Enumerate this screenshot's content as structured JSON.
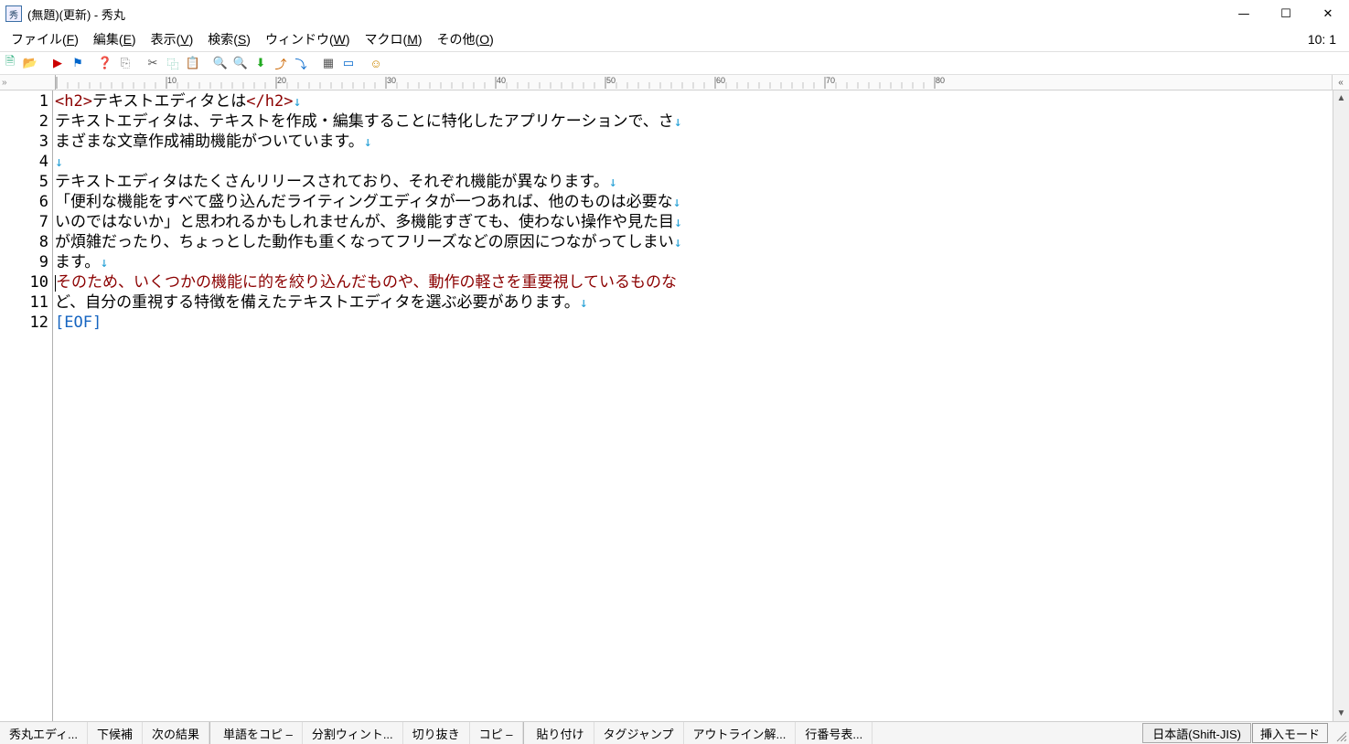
{
  "titlebar": {
    "text": "(無題)(更新) - 秀丸"
  },
  "window_controls": {
    "minimize": "—",
    "maximize": "☐",
    "close": "✕"
  },
  "menubar": {
    "items": [
      {
        "label": "ファイル",
        "accel": "F"
      },
      {
        "label": "編集",
        "accel": "E"
      },
      {
        "label": "表示",
        "accel": "V"
      },
      {
        "label": "検索",
        "accel": "S"
      },
      {
        "label": "ウィンドウ",
        "accel": "W"
      },
      {
        "label": "マクロ",
        "accel": "M"
      },
      {
        "label": "その他",
        "accel": "O"
      }
    ],
    "position": "10: 1"
  },
  "toolbar": {
    "icons": [
      "new-file",
      "open-file",
      "record",
      "bookmark",
      "",
      "toggle-mark",
      "clip",
      "cut",
      "copy",
      "paste",
      "search",
      "find-prev",
      "find-next",
      "jump",
      "",
      "view1",
      "split",
      "help"
    ]
  },
  "ruler": {
    "marks": [
      10,
      20,
      30,
      40,
      50,
      60,
      70
    ]
  },
  "lines": {
    "count": 12,
    "content": [
      {
        "n": 1,
        "type": "tagged",
        "open": "<h2>",
        "text": "テキストエディタとは",
        "close": "</h2>"
      },
      {
        "n": 2,
        "type": "plain",
        "text": "テキストエディタは、テキストを作成・編集することに特化したアプリケーションで、さ"
      },
      {
        "n": 3,
        "type": "plain",
        "text": "まざまな文章作成補助機能がついています。"
      },
      {
        "n": 4,
        "type": "empty",
        "text": ""
      },
      {
        "n": 5,
        "type": "plain",
        "text": "テキストエディタはたくさんリリースされており、それぞれ機能が異なります。"
      },
      {
        "n": 6,
        "type": "plain",
        "text": "「便利な機能をすべて盛り込んだライティングエディタが一つあれば、他のものは必要な"
      },
      {
        "n": 7,
        "type": "plain",
        "text": "いのではないか」と思われるかもしれませんが、多機能すぎても、使わない操作や見た目"
      },
      {
        "n": 8,
        "type": "plain",
        "text": "が煩雑だったり、ちょっとした動作も重くなってフリーズなどの原因につながってしまい"
      },
      {
        "n": 9,
        "type": "plain",
        "text": "ます。"
      },
      {
        "n": 10,
        "type": "highlight",
        "text": "そのため、いくつかの機能に的を絞り込んだものや、動作の軽さを重要視しているものな"
      },
      {
        "n": 11,
        "type": "plain",
        "text": "ど、自分の重視する特徴を備えたテキストエディタを選ぶ必要があります。"
      },
      {
        "n": 12,
        "type": "eof",
        "text": "[EOF]"
      }
    ],
    "return_mark": "↓",
    "caret_line": 10
  },
  "statusbar": {
    "items": [
      "秀丸エディ...",
      "下候補",
      "次の結果",
      "単語をコピ –",
      "分割ウィント...",
      "切り抜き",
      "コピ –",
      "貼り付け",
      "タグジャンプ",
      "アウトライン解...",
      "行番号表..."
    ],
    "encoding": "日本語(Shift-JIS)",
    "insert_mode": "挿入モード"
  }
}
